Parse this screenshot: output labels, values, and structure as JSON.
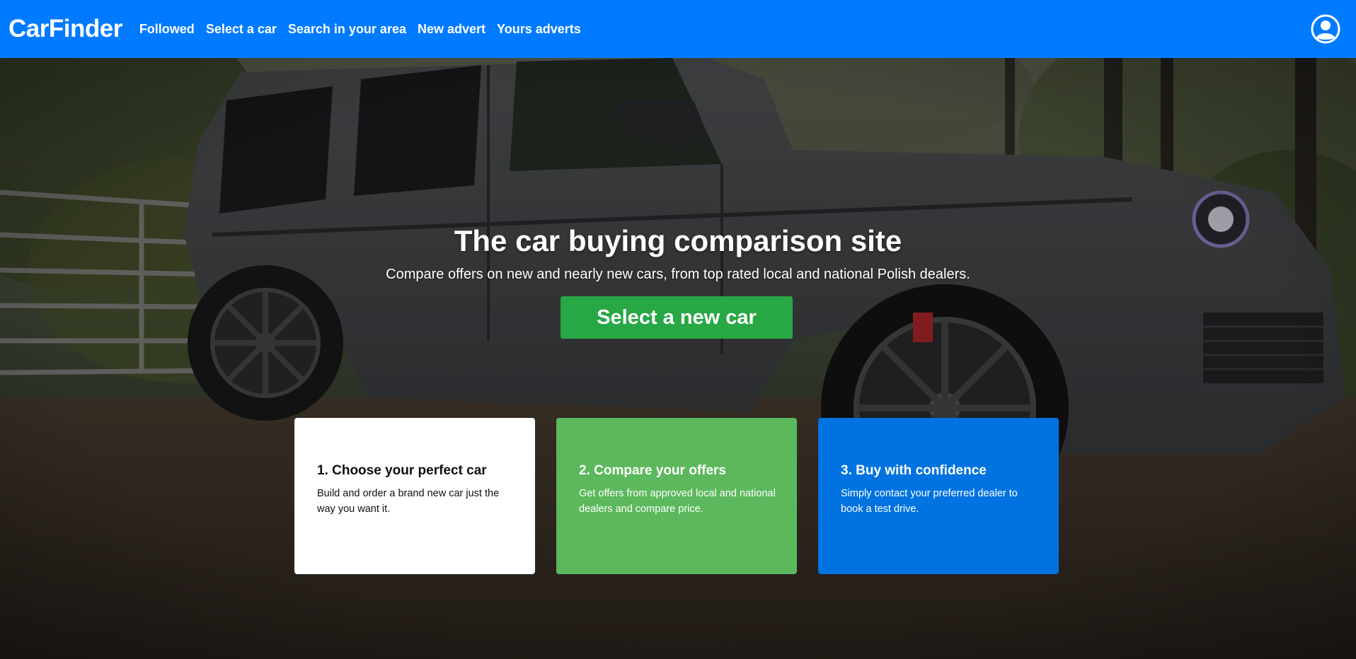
{
  "navbar": {
    "brand": "CarFinder",
    "links": [
      {
        "label": "Followed"
      },
      {
        "label": "Select a car"
      },
      {
        "label": "Search in your area"
      },
      {
        "label": "New advert"
      },
      {
        "label": "Yours adverts"
      }
    ],
    "user_icon": "user-circle-icon",
    "background_color": "#007bff"
  },
  "hero": {
    "title": "The car buying comparison site",
    "subtitle": "Compare offers on new and nearly new cars, from top rated local and national Polish dealers.",
    "cta_label": "Select a new car",
    "cta_color": "#28a745"
  },
  "steps": [
    {
      "title": "1. Choose your perfect car",
      "text": "Build and order a brand new car just the way you want it.",
      "color": "#ffffff"
    },
    {
      "title": "2. Compare your offers",
      "text": "Get offers from approved local and national dealers and compare price.",
      "color": "#5cb85c"
    },
    {
      "title": "3. Buy with confidence",
      "text": "Simply contact your preferred dealer to book a test drive.",
      "color": "#0073e0"
    }
  ]
}
